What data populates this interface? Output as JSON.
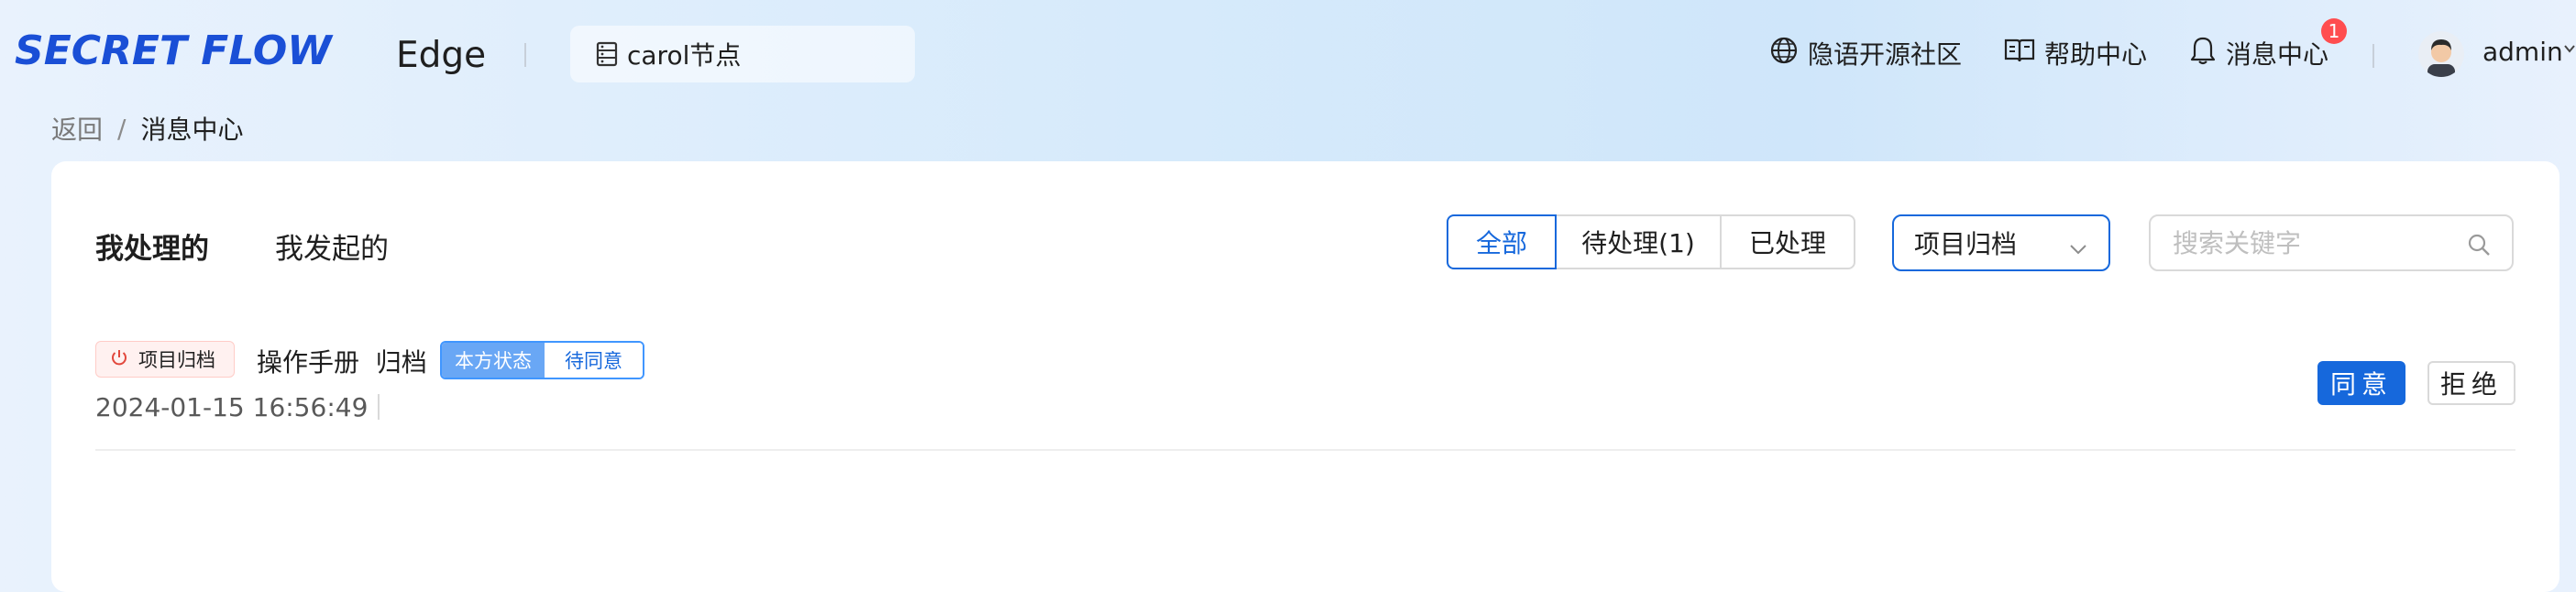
{
  "header": {
    "logo_text": "SECRET FLOW",
    "product_name": "Edge",
    "node_selector": {
      "value": "carol节点",
      "icon": "node-list-icon"
    },
    "nav": [
      {
        "label": "隐语开源社区",
        "icon": "globe-icon"
      },
      {
        "label": "帮助中心",
        "icon": "book-icon"
      },
      {
        "label": "消息中心",
        "icon": "bell-icon",
        "badge": "1"
      }
    ],
    "user": {
      "name": "admin",
      "avatar": "avatar-icon"
    }
  },
  "breadcrumb": {
    "back": "返回",
    "separator": "/",
    "current": "消息中心"
  },
  "tabs": {
    "mine": "我处理的",
    "sent": "我发起的",
    "active": "mine"
  },
  "filters": {
    "segments": [
      {
        "label": "全部",
        "active": true
      },
      {
        "label": "待处理(1)",
        "active": false
      },
      {
        "label": "已处理",
        "active": false
      }
    ],
    "type_select": {
      "value": "项目归档"
    },
    "search": {
      "placeholder": "搜索关键字"
    }
  },
  "messages": [
    {
      "type_tag": "项目归档",
      "type_icon": "power-icon",
      "title": "操作手册  归档",
      "status_label": "本方状态",
      "status_value": "待同意",
      "time": "2024-01-15 16:56:49",
      "actions": {
        "agree": "同意",
        "reject": "拒绝"
      }
    }
  ],
  "colors": {
    "primary": "#1668dc",
    "badge": "#ff4d4f",
    "tag_red_bg": "#fff1f0",
    "status_label_bg": "#69a7f5"
  }
}
